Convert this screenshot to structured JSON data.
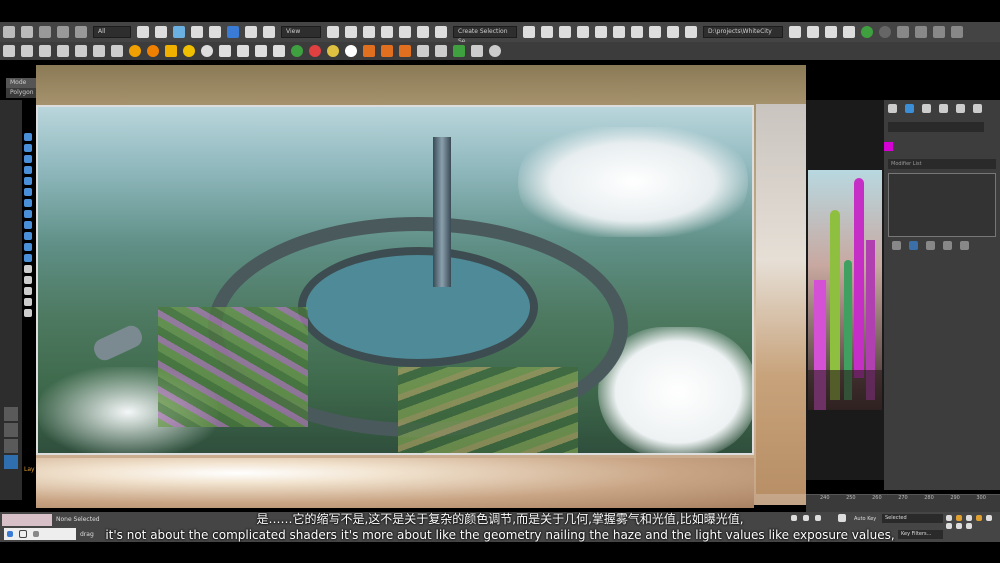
{
  "toolbar": {
    "filter_selected": "All",
    "view_selected": "View",
    "selection_set_placeholder": "Create Selection Se",
    "project_path": "D:\\projects\\WhiteCity"
  },
  "scene_tabs": {
    "tab1": "Mode",
    "tab2": "Polygon M"
  },
  "command_panel": {
    "modifier_list": "Modifier List"
  },
  "timeline": {
    "ticks": [
      "240",
      "250",
      "260",
      "270",
      "280",
      "290",
      "300"
    ],
    "auto_key": "Auto Key",
    "set_key_mode": "Selected",
    "key_filters": "Key Filters..."
  },
  "status": {
    "none_selected": "None Selected",
    "prompt": "drag",
    "layer_label": "Lay"
  },
  "subtitles": {
    "chinese": "是……它的缩写不是,这不是关于复杂的颜色调节,而是关于几何,掌握雾气和光值,比如曝光值,",
    "english": "it's not about the complicated shaders it's more about like the geometry nailing the haze and the light values like exposure values,"
  },
  "colors": {
    "ui_bg": "#444444",
    "accent_magenta": "#d400d4",
    "accent_green": "#3fa040"
  },
  "icons": [
    "undo-icon",
    "redo-icon",
    "link-icon",
    "select-icon",
    "move-icon",
    "rotate-icon",
    "scale-icon",
    "snap-icon",
    "render-icon",
    "material-icon"
  ]
}
